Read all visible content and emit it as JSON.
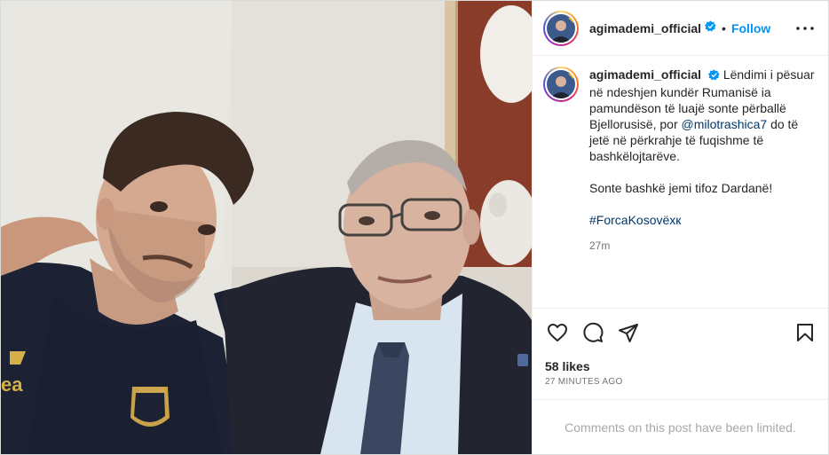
{
  "post": {
    "username": "agimademi_official",
    "follow_label": "Follow",
    "separator": "•",
    "caption": {
      "part1": "Lëndimi i pësuar në ndeshjen kundër Rumanisë ia pamundëson të luajë sonte përballë Bjellorusisë, por ",
      "mention": "@milotrashica7",
      "part2": " do të jetë në përkrahje të fuqishme të bashkëlojtarëve.",
      "paragraph2": "Sonte bashkë jemi tifoz Dardanë!",
      "hashtag": "#ForcaKosovëxк"
    },
    "time_ago": "27m",
    "likes": "58 likes",
    "posted_ago": "27 minutes ago",
    "comments_notice": "Comments on this post have been limited."
  },
  "photo": {
    "shirt_badge": "KOSOVA",
    "sponsor_mark": "ea"
  },
  "icons": {
    "verified": "verified-badge-icon",
    "more": "more-options-icon",
    "like": "heart-icon",
    "comment": "comment-bubble-icon",
    "share": "share-paper-plane-icon",
    "save": "bookmark-icon"
  },
  "colors": {
    "accent": "#0095f6",
    "link": "#00376b",
    "muted": "#737373",
    "limited_text": "#a8a8a8"
  }
}
